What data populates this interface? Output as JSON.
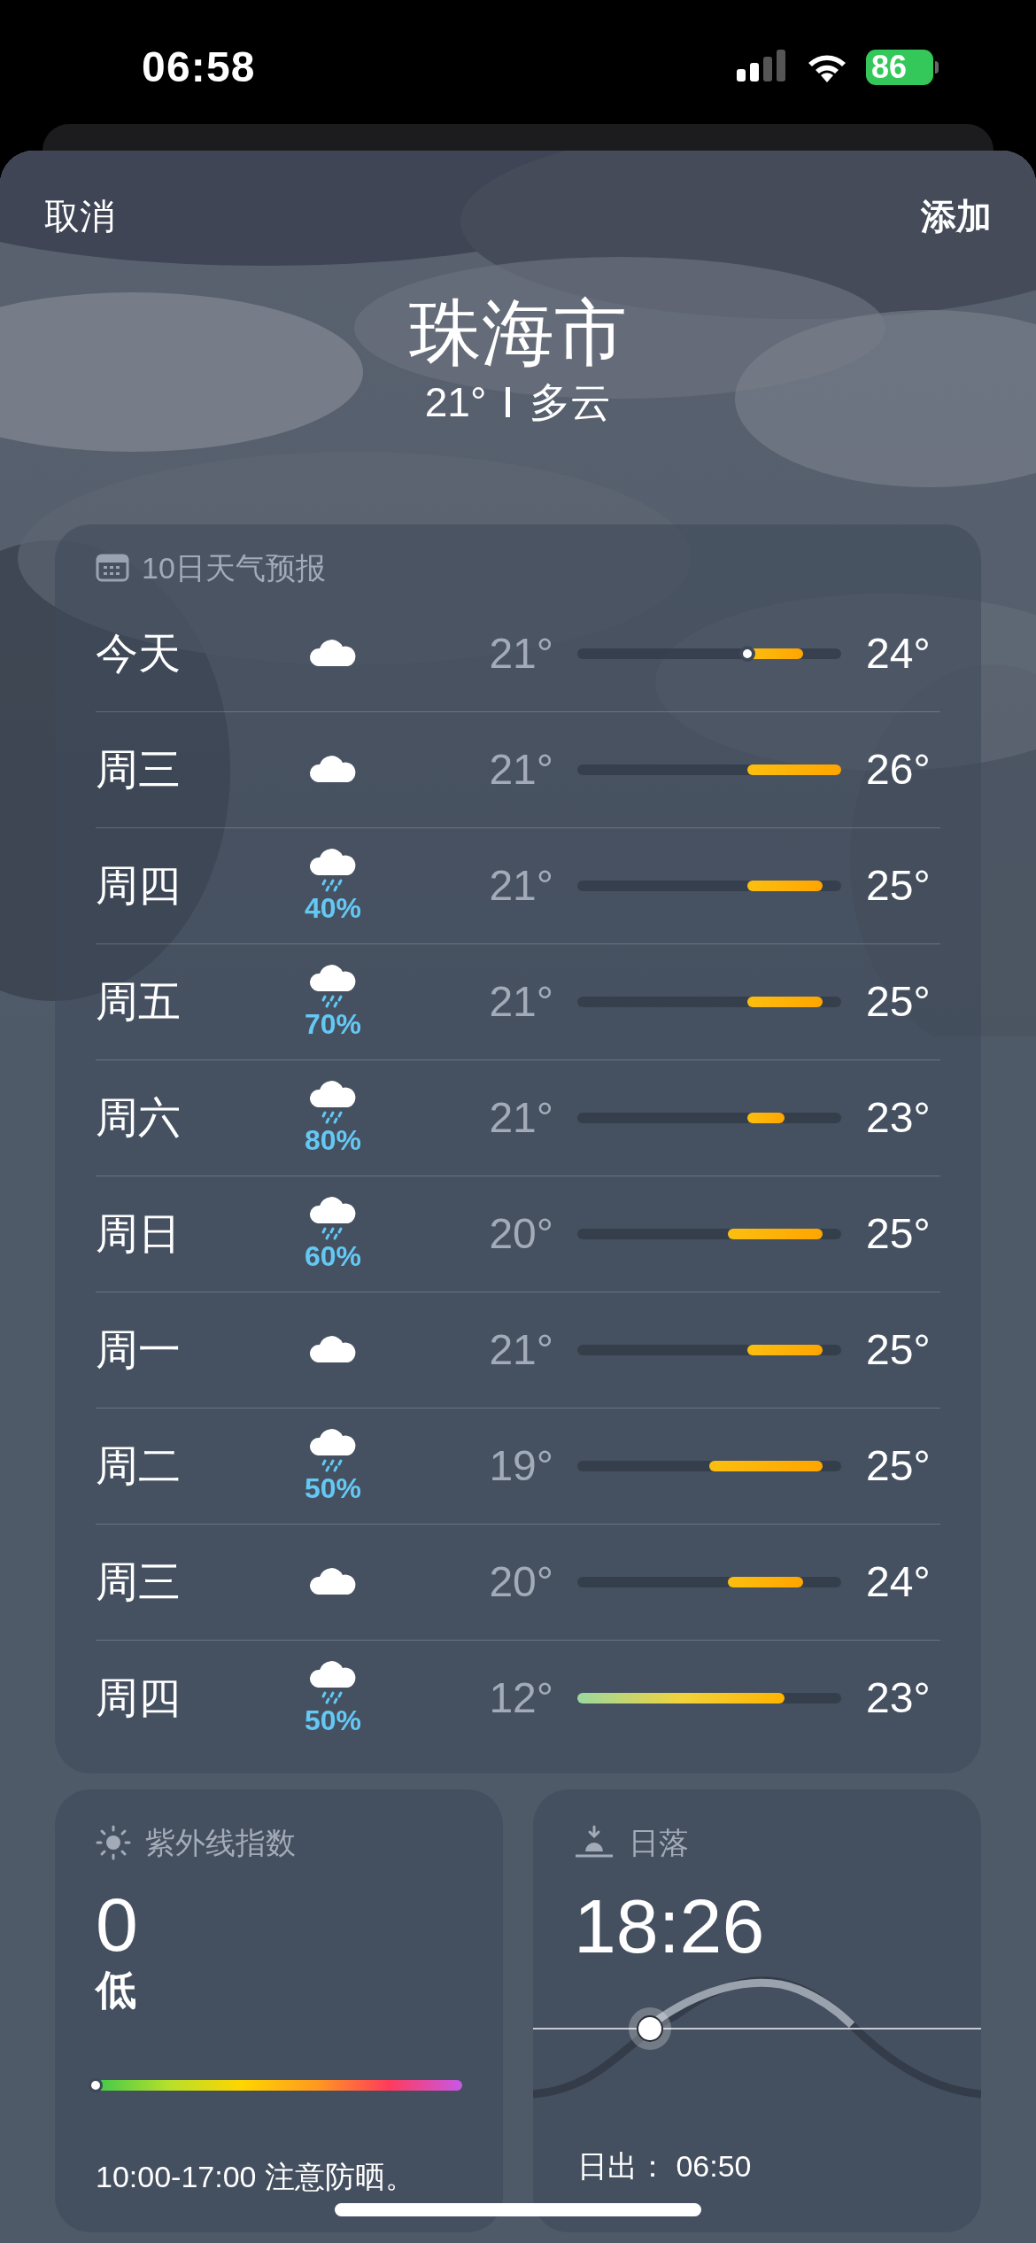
{
  "status_bar": {
    "time": "06:58",
    "battery": "86"
  },
  "header": {
    "cancel": "取消",
    "add": "添加",
    "city": "珠海市",
    "temperature": "21°",
    "condition": "多云"
  },
  "forecast": {
    "title": "10日天气预报",
    "days": [
      {
        "day": "今天",
        "kind": "cloud",
        "low": "21°",
        "high": "24°",
        "now": true
      },
      {
        "day": "周三",
        "kind": "cloud",
        "low": "21°",
        "high": "26°",
        "now": false
      },
      {
        "day": "周四",
        "kind": "rain",
        "precip": "40%",
        "low": "21°",
        "high": "25°",
        "now": false
      },
      {
        "day": "周五",
        "kind": "rain",
        "precip": "70%",
        "low": "21°",
        "high": "25°",
        "now": false
      },
      {
        "day": "周六",
        "kind": "rain",
        "precip": "80%",
        "low": "21°",
        "high": "23°",
        "now": false
      },
      {
        "day": "周日",
        "kind": "rain",
        "precip": "60%",
        "low": "20°",
        "high": "25°",
        "now": false
      },
      {
        "day": "周一",
        "kind": "cloud",
        "low": "21°",
        "high": "25°",
        "now": false
      },
      {
        "day": "周二",
        "kind": "rain",
        "precip": "50%",
        "low": "19°",
        "high": "25°",
        "now": false
      },
      {
        "day": "周三",
        "kind": "cloud",
        "low": "20°",
        "high": "24°",
        "now": false
      },
      {
        "day": "周四",
        "kind": "rain",
        "precip": "50%",
        "low": "12°",
        "high": "23°",
        "now": false
      }
    ]
  },
  "uv": {
    "title": "紫外线指数",
    "value": "0",
    "category": "低",
    "level": 0,
    "note": "10:00-17:00 注意防晒。"
  },
  "sunset": {
    "title": "日落",
    "time": "18:26",
    "sunrise": "日出： 06:50"
  }
}
